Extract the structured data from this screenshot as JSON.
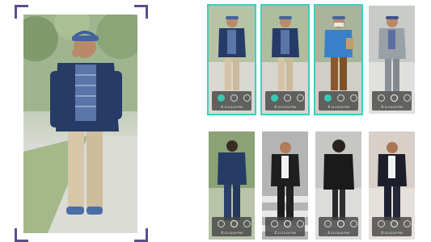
{
  "query": {
    "image": "man-walking-phone-photo"
  },
  "results": [
    {
      "image": "blue-jacket-man-walking",
      "selected": true,
      "time": "⏱ 11:13:04 PM"
    },
    {
      "image": "blue-jacket-man-walking",
      "selected": true,
      "time": "⏱ 11:13:04 PM"
    },
    {
      "image": "masked-blue-shirt-man",
      "selected": true,
      "time": "⏱ 11:13:04 PM"
    },
    {
      "image": "grey-suit-man",
      "selected": false,
      "time": "⏱ 11:13:04 PM"
    },
    {
      "image": "back-view-man",
      "selected": false,
      "time": "⏱ 11:13:04 PM"
    },
    {
      "image": "crosswalk-man",
      "selected": false,
      "time": "⏱ 11:13:04 PM"
    },
    {
      "image": "back-view-woman",
      "selected": false,
      "time": "⏱ 11:13:04 PM"
    },
    {
      "image": "black-blazer-man",
      "selected": false,
      "time": "⏱ 11:13:04 PM"
    }
  ],
  "colors": {
    "accent": "#38d1bf",
    "frame": "#5b4e8c"
  }
}
